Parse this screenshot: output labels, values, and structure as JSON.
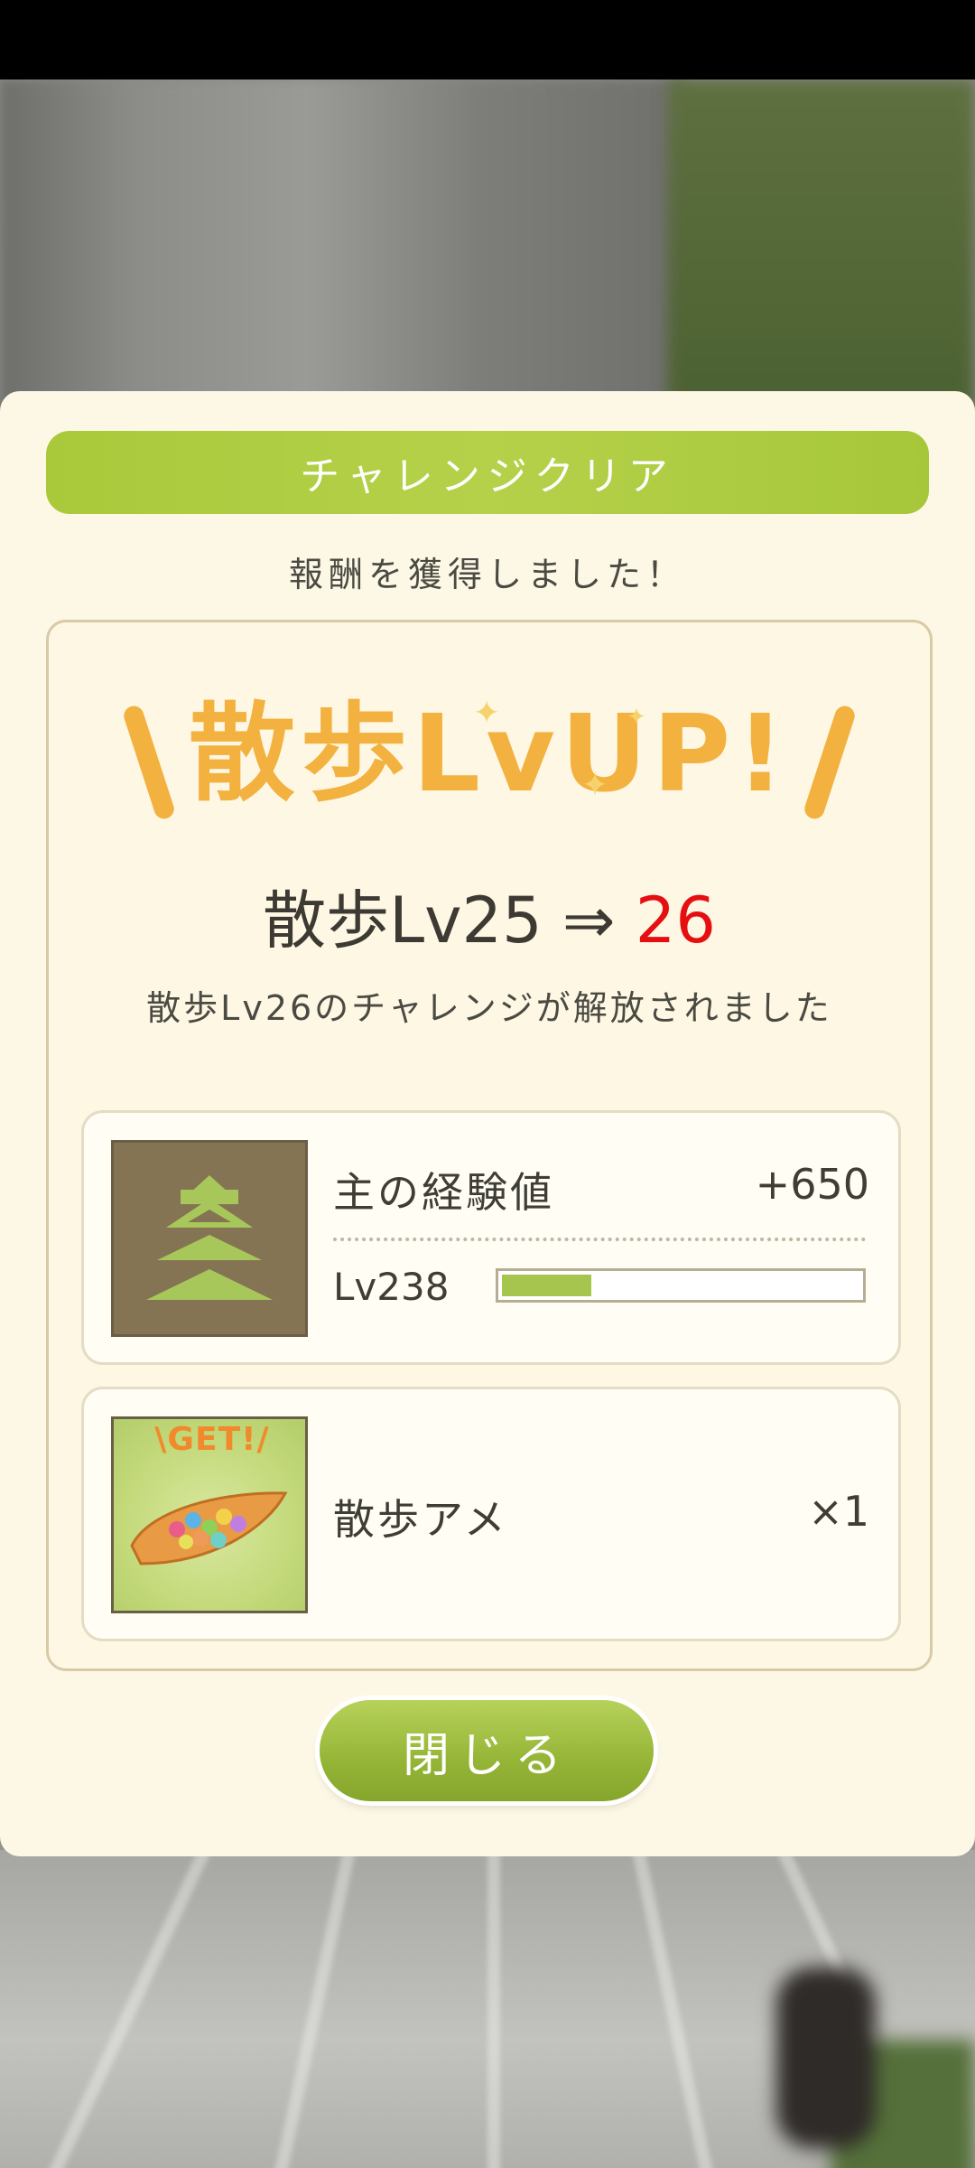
{
  "dialog": {
    "banner_title": "チャレンジクリア",
    "subtitle": "報酬を獲得しました！",
    "lvup_title": "散歩LvUP!",
    "level_change": {
      "prefix": "散歩Lv25 ⇒ ",
      "new_level": "26"
    },
    "unlock_message": "散歩Lv26のチャレンジが解放されました",
    "rewards": [
      {
        "icon": "castle-icon",
        "label": "主の経験値",
        "value": "+650",
        "level_label": "Lv238",
        "progress": 0.25
      },
      {
        "icon": "candy-icon",
        "badge": "\\GET!/",
        "label": "散歩アメ",
        "value": "×1"
      }
    ],
    "close_label": "閉じる"
  },
  "colors": {
    "banner": "#aecb3f",
    "lvup": "#f3b13f",
    "new_level": "#e50f12",
    "button": "#9ab83a"
  }
}
